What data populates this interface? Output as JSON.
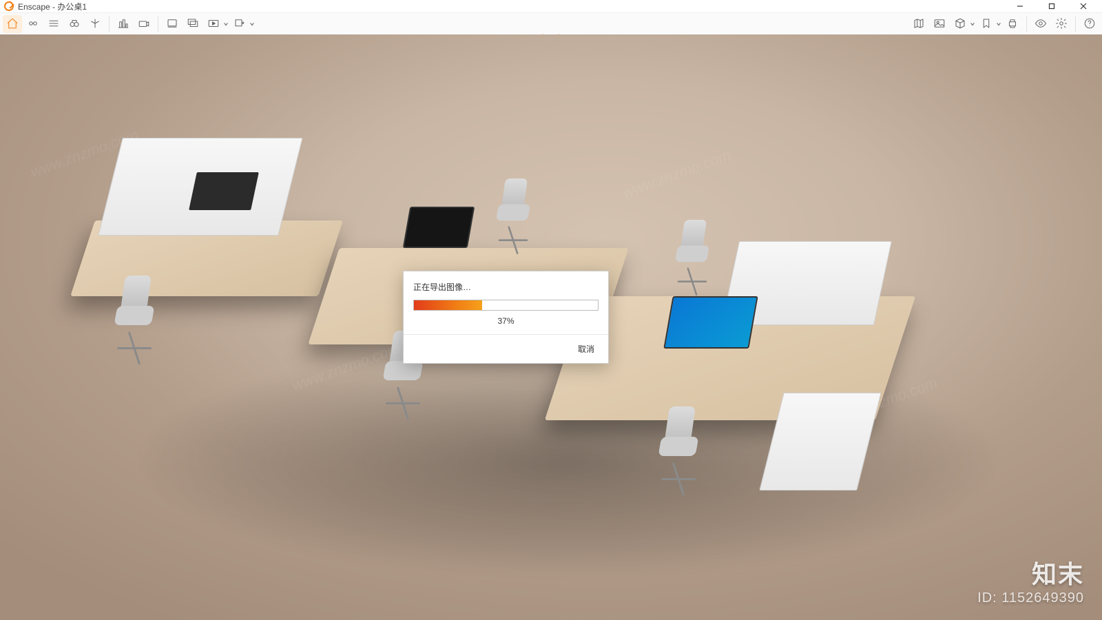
{
  "window": {
    "app_name": "Enscape",
    "document_name": "办公桌1",
    "title": "Enscape - 办公桌1"
  },
  "window_controls": {
    "minimize": "minimize",
    "maximize": "maximize",
    "close": "close"
  },
  "toolbar": {
    "left_groups": [
      {
        "items": [
          {
            "name": "home-icon",
            "tip": "Home",
            "active": true
          },
          {
            "name": "link-icon",
            "tip": "Live Link"
          },
          {
            "name": "menu-icon",
            "tip": "BIM"
          },
          {
            "name": "binoculars-icon",
            "tip": "Views"
          },
          {
            "name": "favorite-icon",
            "tip": "Favorite"
          }
        ]
      },
      {
        "items": [
          {
            "name": "cityscape-icon",
            "tip": "3D"
          },
          {
            "name": "camera-icon",
            "tip": "Camera"
          }
        ]
      },
      {
        "items": [
          {
            "name": "screenshot-icon",
            "tip": "Screenshot"
          },
          {
            "name": "batch-screenshot-icon",
            "tip": "Batch"
          },
          {
            "name": "video-icon",
            "tip": "Video",
            "has_dropdown": true
          },
          {
            "name": "export-icon",
            "tip": "Export",
            "has_dropdown": true
          }
        ]
      }
    ],
    "right_groups": [
      {
        "items": [
          {
            "name": "map-icon",
            "tip": "Map"
          },
          {
            "name": "image-icon",
            "tip": "Image"
          },
          {
            "name": "cube-icon",
            "tip": "Assets",
            "has_dropdown": true
          },
          {
            "name": "bookmark-icon",
            "tip": "Bookmarks",
            "has_dropdown": true
          },
          {
            "name": "print-icon",
            "tip": "Print"
          }
        ]
      },
      {
        "items": [
          {
            "name": "eye-icon",
            "tip": "Visual settings"
          },
          {
            "name": "gear-icon",
            "tip": "Settings"
          }
        ]
      },
      {
        "items": [
          {
            "name": "help-icon",
            "tip": "Help"
          }
        ]
      }
    ]
  },
  "dialog": {
    "title": "正在导出图像…",
    "progress_percent": 37,
    "progress_label": "37%",
    "cancel_label": "取消"
  },
  "watermark": {
    "brand": "知末",
    "id_line": "ID: 1152649390",
    "diag_text": "www.znzmo.com"
  },
  "colors": {
    "accent": "#f08018",
    "progress_start": "#e23b1a",
    "progress_end": "#f6a11b"
  }
}
